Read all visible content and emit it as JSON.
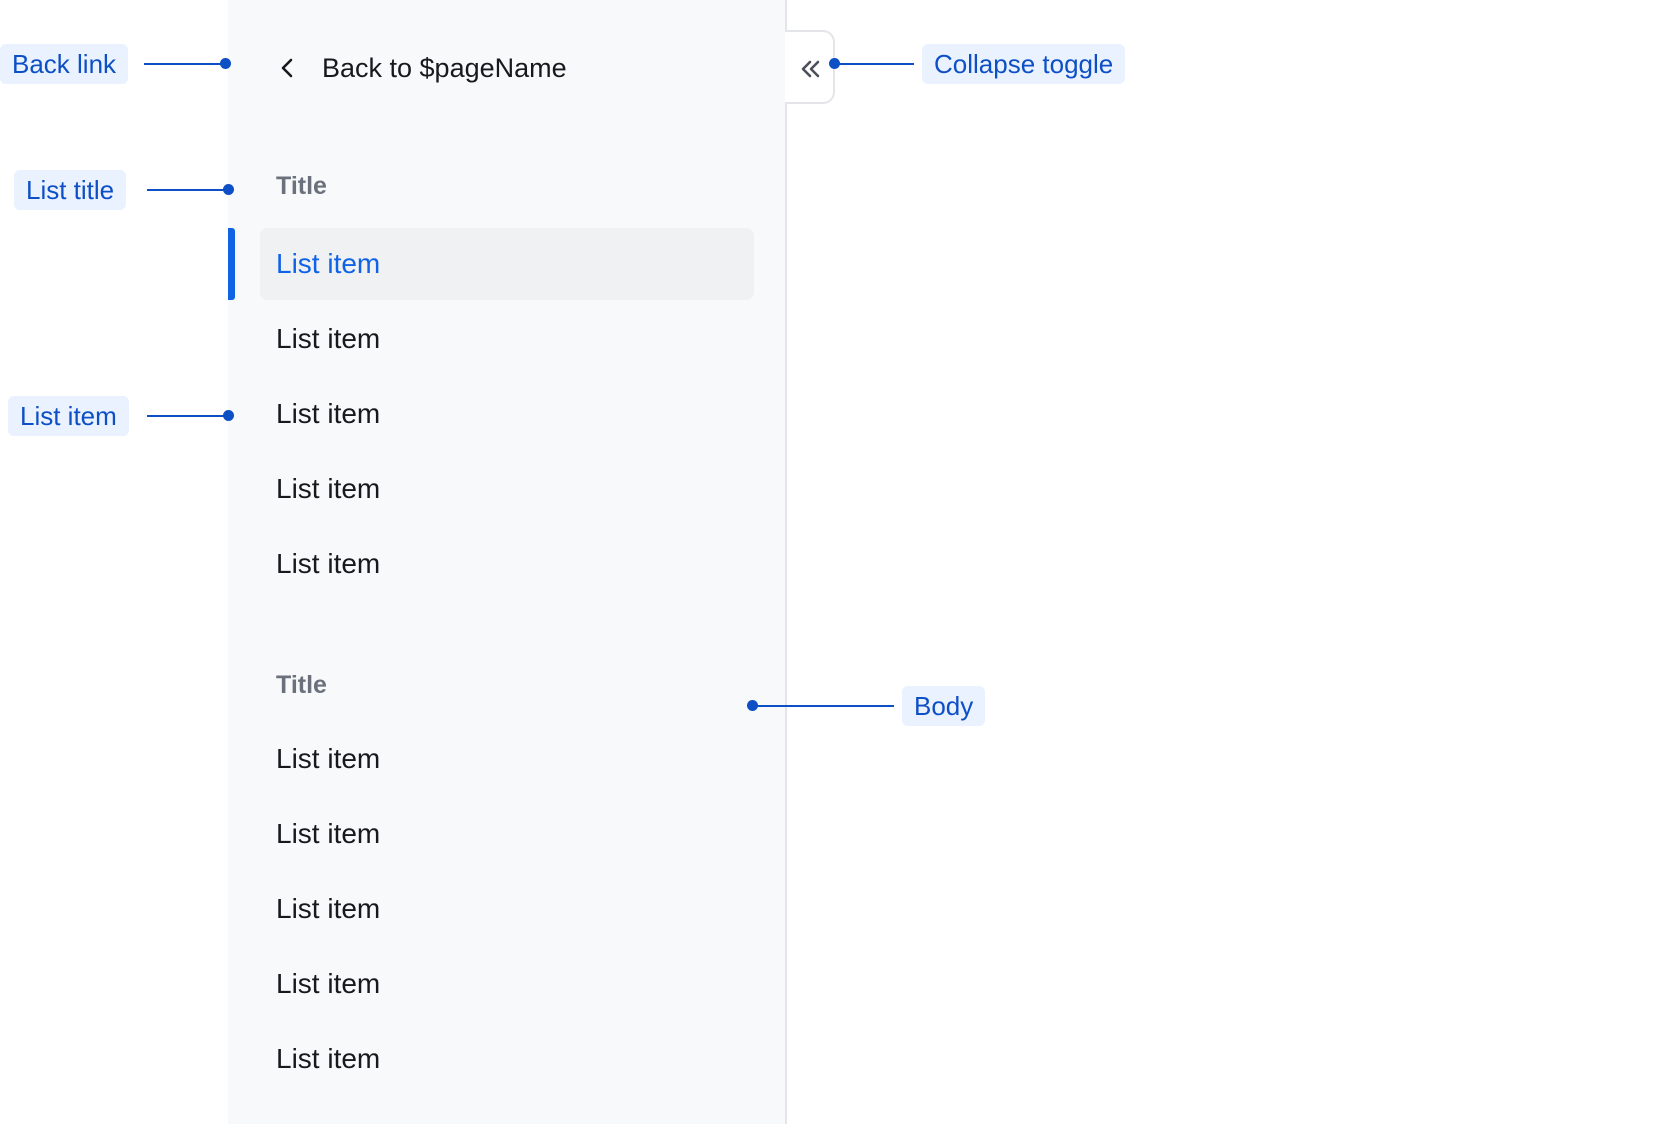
{
  "sidebar": {
    "back_link_label": "Back to $pageName",
    "sections": [
      {
        "title": "Title",
        "items": [
          "List item",
          "List item",
          "List item",
          "List item",
          "List item"
        ],
        "active_index": 0
      },
      {
        "title": "Title",
        "items": [
          "List item",
          "List item",
          "List item",
          "List item",
          "List item"
        ]
      }
    ]
  },
  "annotations": {
    "back_link": "Back link",
    "list_title": "List title",
    "list_item": "List item",
    "collapse_toggle": "Collapse toggle",
    "body": "Body"
  },
  "icons": {
    "back": "chevron-left-icon",
    "collapse": "double-chevron-left-icon"
  },
  "colors": {
    "accent": "#1163e6",
    "annotation": "#0d4fc5",
    "annotation_bg": "#eaf2ff",
    "sidebar_bg": "#f8f9fa"
  }
}
